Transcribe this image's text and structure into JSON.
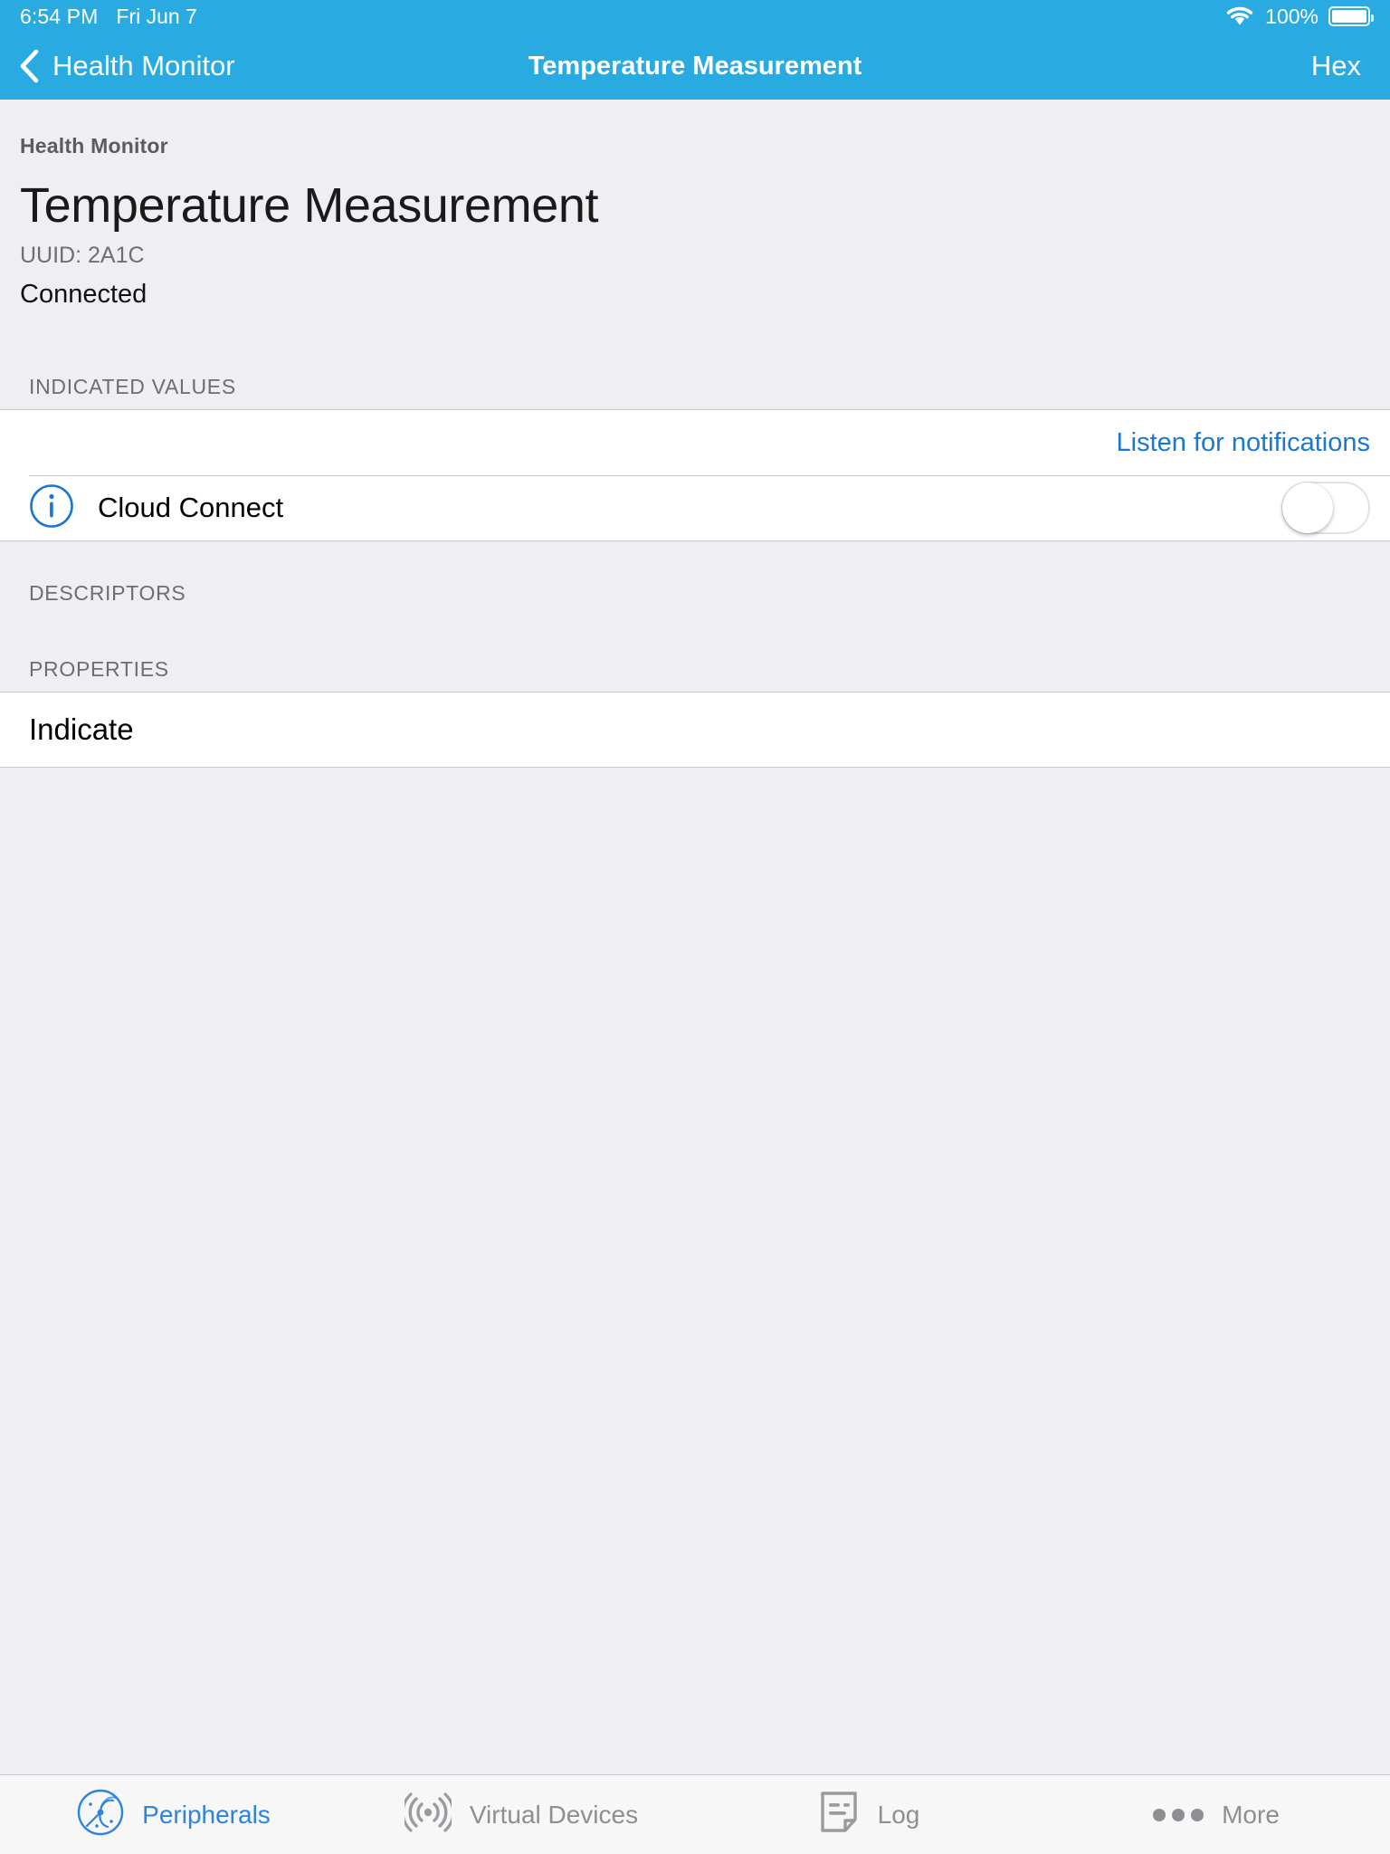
{
  "status_bar": {
    "time": "6:54 PM",
    "date": "Fri Jun 7",
    "wifi_icon": "wifi-icon",
    "battery_percent": "100%",
    "battery_icon": "battery-full-icon"
  },
  "nav_bar": {
    "back_icon": "chevron-left-icon",
    "back_label": "Health Monitor",
    "title": "Temperature Measurement",
    "action_label": "Hex"
  },
  "header": {
    "breadcrumb": "Health Monitor",
    "title": "Temperature Measurement",
    "uuid": "UUID: 2A1C",
    "connection_status": "Connected"
  },
  "sections": {
    "indicated_values": {
      "header": "INDICATED VALUES",
      "listen_link": "Listen for notifications",
      "cloud_connect": {
        "info_icon": "info-circle-icon",
        "label": "Cloud Connect",
        "toggle_state": "off"
      }
    },
    "descriptors": {
      "header": "DESCRIPTORS"
    },
    "properties": {
      "header": "PROPERTIES",
      "items": [
        {
          "label": "Indicate"
        }
      ]
    }
  },
  "tab_bar": {
    "tabs": [
      {
        "label": "Peripherals",
        "icon": "radar-icon",
        "active": true
      },
      {
        "label": "Virtual Devices",
        "icon": "broadcast-icon",
        "active": false
      },
      {
        "label": "Log",
        "icon": "document-icon",
        "active": false
      },
      {
        "label": "More",
        "icon": "ellipsis-icon",
        "active": false
      }
    ]
  },
  "colors": {
    "accent_blue": "#29ABE2",
    "link_blue": "#1878D4",
    "tab_active_blue": "#2A84E0",
    "background": "#EFEEF3",
    "row_background": "#FFFFFF",
    "separator": "#C8C7CC",
    "secondary_text": "#6D6D72"
  }
}
